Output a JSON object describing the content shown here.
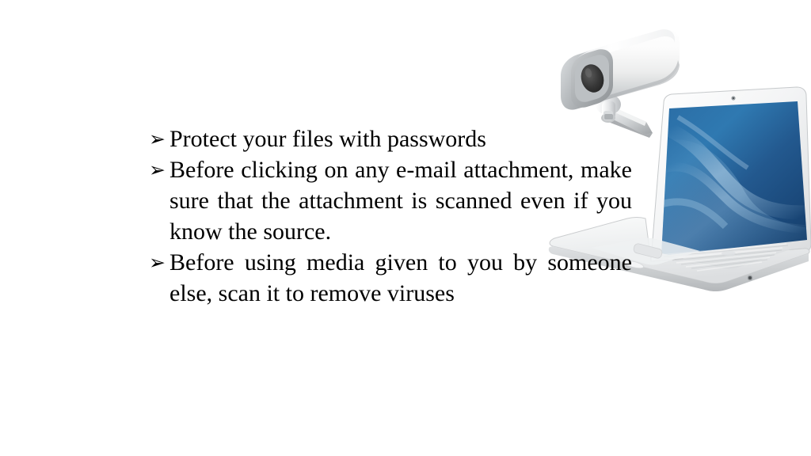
{
  "slide": {
    "background_color": "#ffffff",
    "text_color": "#000000",
    "bullet_glyph": "➢"
  },
  "bullets": [
    {
      "marker": "➢",
      "text": "Protect your files with passwords"
    },
    {
      "marker": "➢",
      "text": "Before clicking on any e-mail attachment, make sure that the attachment is scanned even if you know the source."
    },
    {
      "marker": "➢",
      "text": "Before using media given to you by someone else, scan it to remove viruses"
    }
  ],
  "images": {
    "cctv_camera": {
      "name": "cctv-security-camera",
      "body_color": "#f2f2f2",
      "body_shadow_color": "#b8bcbf",
      "lens_color": "#3a3a3a",
      "bracket_color": "#d8dadc"
    },
    "laptop": {
      "name": "white-laptop",
      "case_color": "#e9eaec",
      "case_edge_color": "#c9cbcd",
      "screen_color_dark": "#15406f",
      "screen_color_light": "#5e95c4",
      "bezel_color": "#f4f5f6",
      "keyboard_color": "#dfe1e3"
    }
  }
}
